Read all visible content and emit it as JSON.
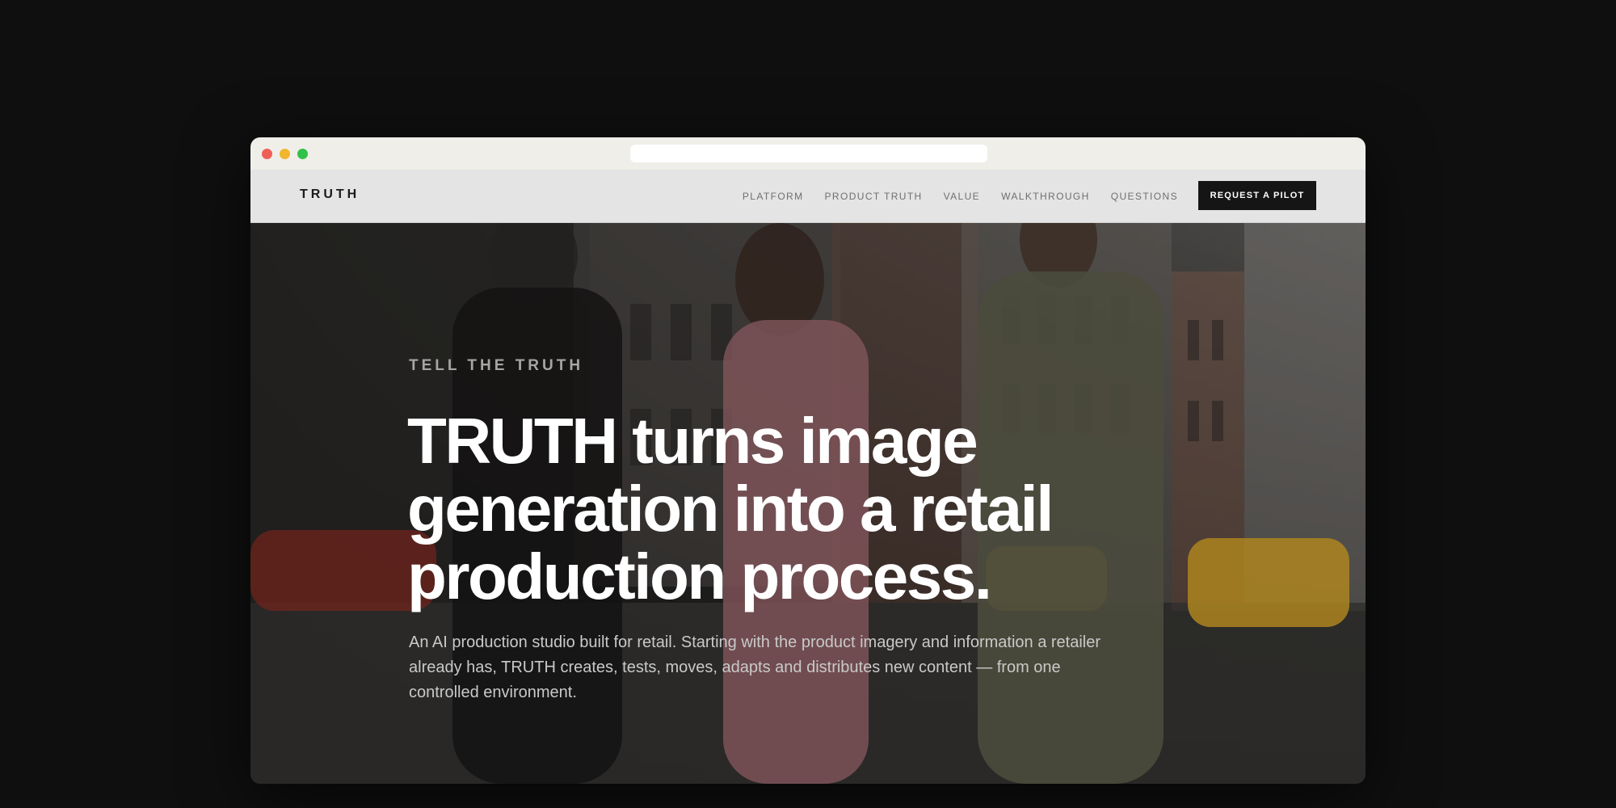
{
  "browser": {
    "address_value": ""
  },
  "nav": {
    "logo": "TRUTH",
    "links": [
      {
        "label": "PLATFORM"
      },
      {
        "label": "PRODUCT TRUTH"
      },
      {
        "label": "VALUE"
      },
      {
        "label": "WALKTHROUGH"
      },
      {
        "label": "QUESTIONS"
      }
    ],
    "cta_label": "REQUEST A PILOT"
  },
  "hero": {
    "eyebrow": "TELL THE TRUTH",
    "headline": "TRUTH turns image generation into a retail production process.",
    "subtext": "An AI production studio built for retail. Starting with the product imagery and information a retailer already has, TRUTH creates, tests, moves, adapts and distributes new content — from one controlled environment."
  },
  "colors": {
    "page_background": "#0f0f0f",
    "chrome_bar": "#efeee9",
    "navbar": "#e4e4e4",
    "cta_background": "#151515",
    "traffic_red": "#ee5f57",
    "traffic_yellow": "#f1b62e",
    "traffic_green": "#30c148"
  }
}
